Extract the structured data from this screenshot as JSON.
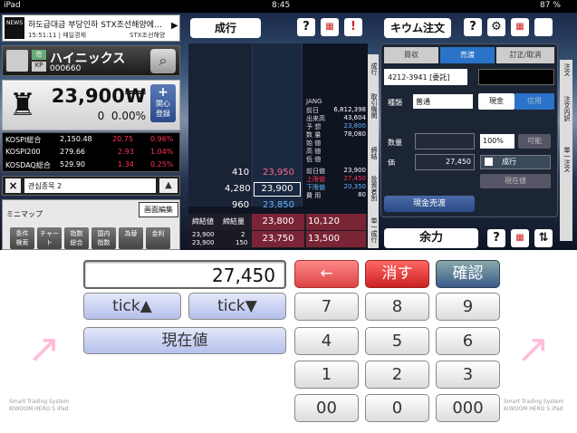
{
  "status": {
    "device": "iPad",
    "time": "8:45",
    "battery": "87 %"
  },
  "news": {
    "icon": "NEWS",
    "headline": "하도급대금 부당인하 STX조선해양에…",
    "time": "15:51:11 | 매일경제",
    "source": "STX조선해양"
  },
  "stock": {
    "badge": "信",
    "badge2": "KP",
    "name": "ハイニックス",
    "code": "000660",
    "price": "23,900₩",
    "change": "0",
    "rate": "0.00%",
    "watch_label": "関心\n登録",
    "watch_plus": "+"
  },
  "indices": [
    {
      "name": "KOSPI総合",
      "value": "2,150.48",
      "change": "20.75",
      "rate": "0.96%"
    },
    {
      "name": "KOSPI200",
      "value": "279.66",
      "change": "2.93",
      "rate": "1.04%"
    },
    {
      "name": "KOSDAQ総合",
      "value": "529.90",
      "change": "1.34",
      "rate": "0.25%"
    }
  ],
  "favorites": {
    "close": "×",
    "selected": "관심종목 2",
    "up": "▲"
  },
  "minimap": {
    "title": "ミニマップ",
    "edit": "画面編集",
    "buttons": [
      "条件\n検索",
      "チャー\nト",
      "指数\n総合",
      "国内\n指数",
      "為替",
      "金利"
    ]
  },
  "order_header": {
    "title": "成行",
    "help": "?",
    "grid": "▦",
    "excl": "!"
  },
  "orderbook": {
    "rows": [
      {
        "qty": "410",
        "price": "23,950",
        "color": "#ff6688"
      },
      {
        "qty": "4,280",
        "price": "23,900",
        "color": "#ffffff"
      },
      {
        "qty": "960",
        "price": "23,850",
        "color": "#6ab4ff"
      }
    ],
    "bottom_row": {
      "label_a": "締結値",
      "label_b": "締結量",
      "price": "23,800",
      "qty": "10,120"
    },
    "bottom_row2": {
      "p1": "23,900",
      "q1": "2",
      "p2": "23,900",
      "q2": "150",
      "price": "23,750",
      "qty": "13,500"
    }
  },
  "info": [
    {
      "label": "JANG",
      "value": ""
    },
    {
      "label": "前日",
      "value": "6,812,398"
    },
    {
      "label": "出来高",
      "value": "43,604"
    },
    {
      "label": "予 想",
      "value": "23,800"
    },
    {
      "label": "数 量",
      "value": "78,080"
    },
    {
      "label": "始 値",
      "value": ""
    },
    {
      "label": "高 値",
      "value": ""
    },
    {
      "label": "低 値",
      "value": ""
    },
    {
      "label": "前日値",
      "value": "23,900"
    },
    {
      "label": "上限値",
      "value": "27,450"
    },
    {
      "label": "下限値",
      "value": "20,350"
    },
    {
      "label": "費 用",
      "value": "80"
    }
  ],
  "side_tabs_left": [
    "成行",
    "取引機関",
    "締結",
    "投資者別",
    "単一成行"
  ],
  "right_header": {
    "title": "キウム注文",
    "help": "?",
    "gear": "⚙",
    "grid": "▦"
  },
  "order_form": {
    "tabs": [
      "買収",
      "売渡",
      "訂正/取消"
    ],
    "account": "4212-3941 [委託]",
    "type_label": "種類",
    "type_value": "普通",
    "cash_label": "現金",
    "credit_label": "信用",
    "qty_label": "数量",
    "qty_pct": "100%",
    "possible": "可能",
    "price_label": "価",
    "price_value": "27,450",
    "market_label": "成行",
    "current_label": "現在値",
    "cash_sell": "現金売渡"
  },
  "side_tabs_right": [
    "注文",
    "注文内訳",
    "単一注文"
  ],
  "balance": {
    "title": "余力",
    "help": "?",
    "grid": "▦",
    "expand": "⇅"
  },
  "keypad": {
    "display": "27,450",
    "tick_up": "tick▲",
    "tick_down": "tick▼",
    "current": "現在値",
    "back": "←",
    "clear": "消す",
    "confirm": "確認",
    "keys": [
      "7",
      "8",
      "9",
      "4",
      "5",
      "6",
      "1",
      "2",
      "3",
      "00",
      "0",
      "000"
    ],
    "brand_line1": "Smart Trading System",
    "brand_line2": "KIWOOM HERO S iPad"
  },
  "colors": {
    "up": "#ff3355",
    "down": "#2a7bff",
    "accent": "#2a73c8"
  }
}
